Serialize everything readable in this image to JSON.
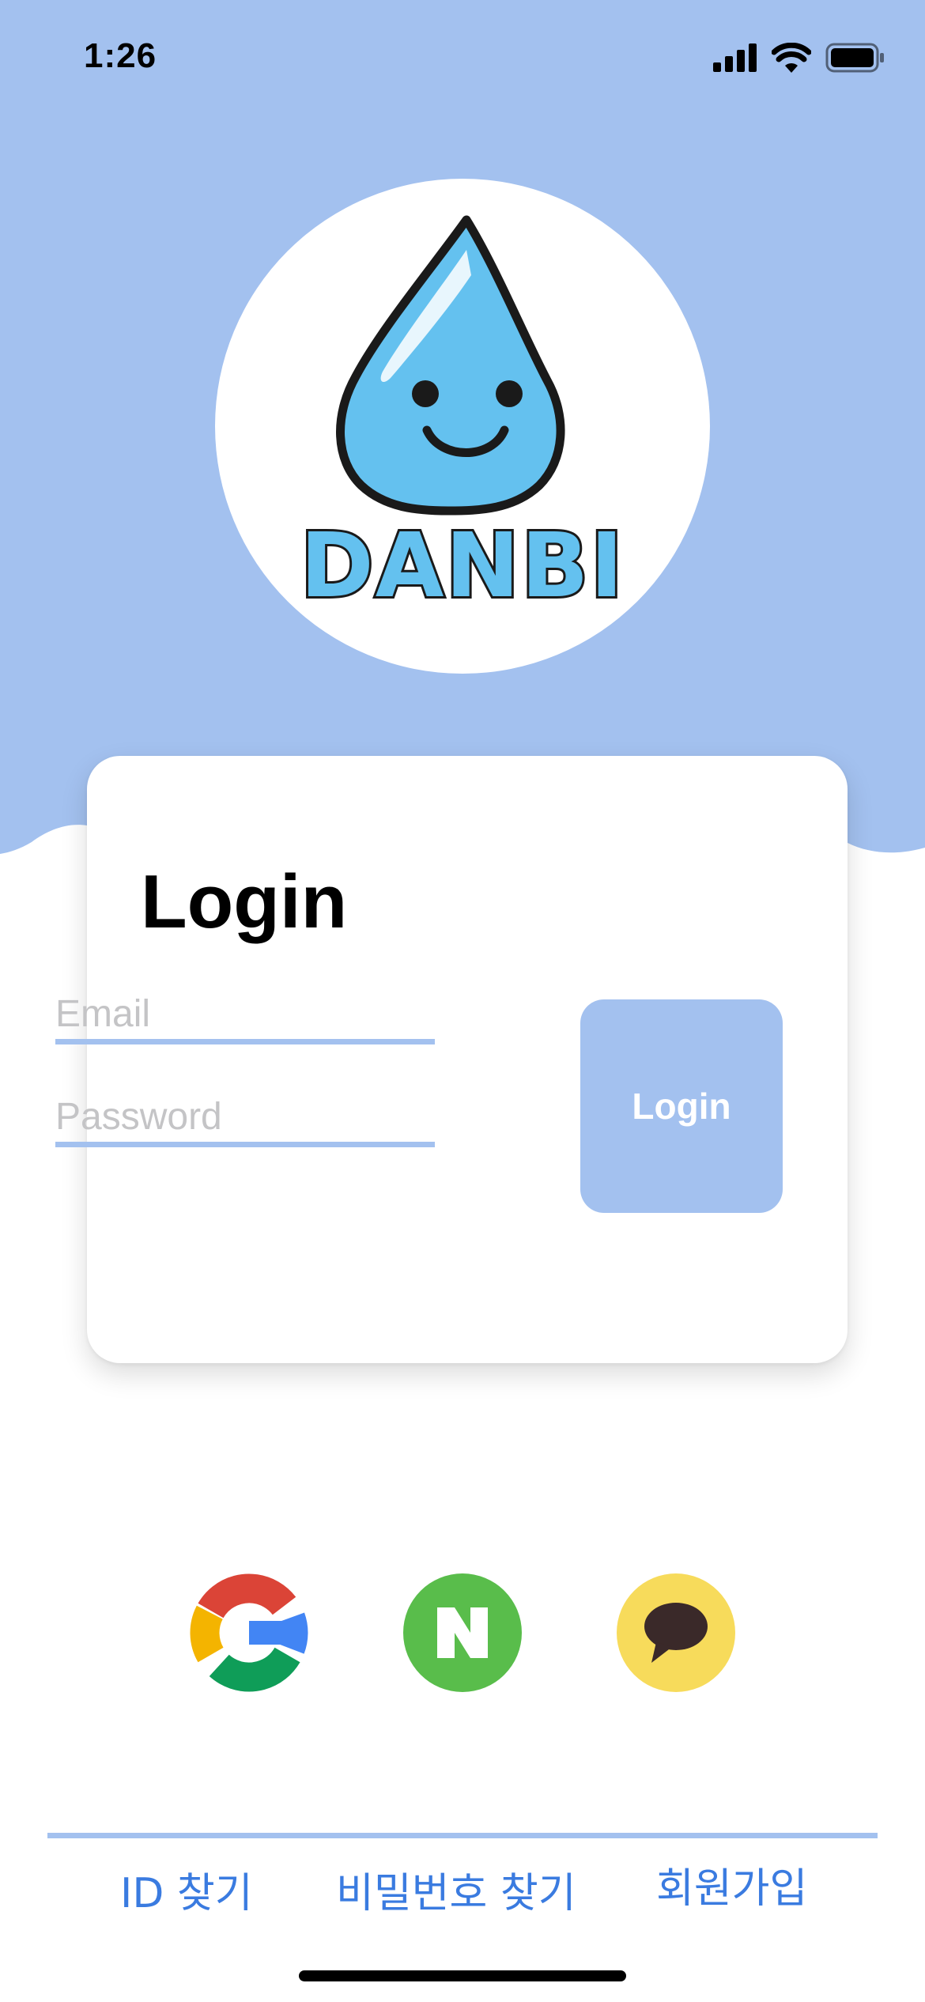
{
  "status_bar": {
    "time": "1:26"
  },
  "logo": {
    "text": "DANBI"
  },
  "login_card": {
    "title": "Login",
    "email_placeholder": "Email",
    "password_placeholder": "Password",
    "login_button_label": "Login"
  },
  "social_login": [
    {
      "name": "google",
      "icon": "google-icon"
    },
    {
      "name": "naver",
      "icon": "naver-icon",
      "color": "#59bd4b"
    },
    {
      "name": "kakao",
      "icon": "kakao-talk-icon",
      "color": "#f7db5b"
    }
  ],
  "footer": {
    "find_id": "ID 찾기",
    "find_password": "비밀번호 찾기",
    "signup": "회원가입"
  },
  "colors": {
    "accent": "#a3c1ef",
    "link": "#3a7be0"
  }
}
